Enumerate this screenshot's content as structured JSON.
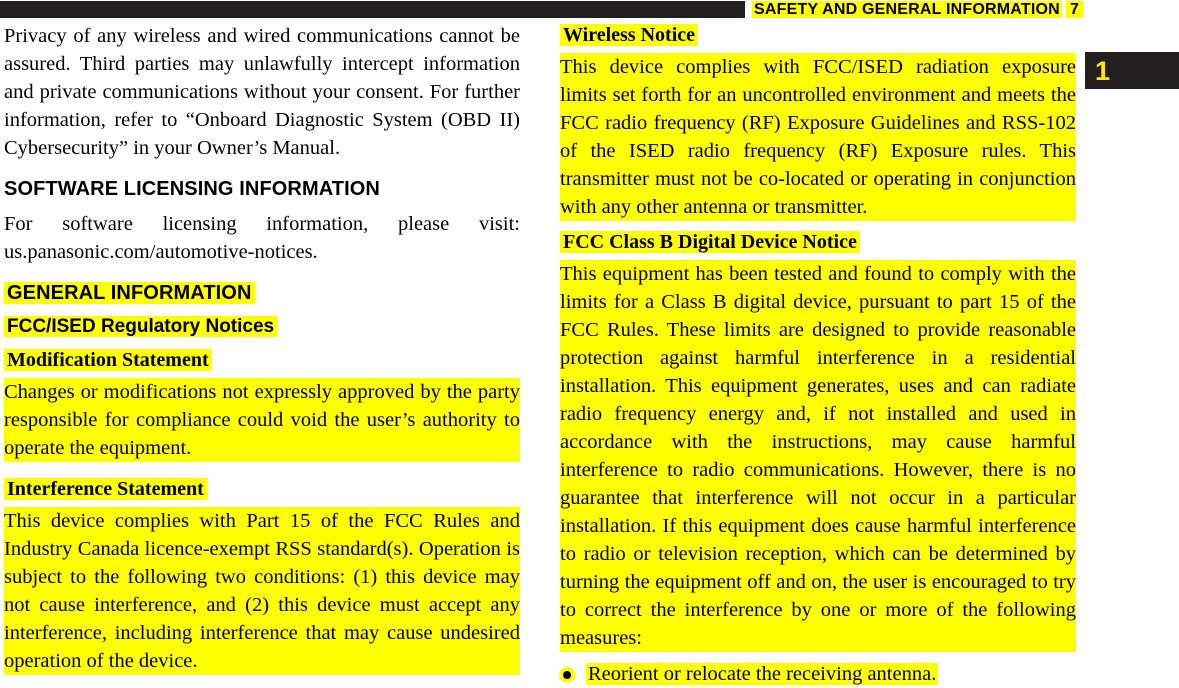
{
  "header": {
    "title": "SAFETY AND GENERAL INFORMATION",
    "page_number": "7",
    "chapter_tab_number": "1",
    "title_highlight_color": "#ffff00",
    "rule_color": "#231f20",
    "tab_color": "#231f20",
    "tab_number_color": "#ffe800"
  },
  "left_column": {
    "intro_paragraph": "Privacy of any wireless and wired communications cannot be assured. Third parties may unlawfully intercept information and private communications without your consent. For further information, refer to “Onboard Diagnostic System (OBD II) Cybersecurity” in your Owner’s Manual.",
    "software_licensing_heading": "SOFTWARE LICENSING INFORMATION",
    "software_licensing_body": "For software licensing information, please visit: us.panasonic.com/automotive-notices.",
    "general_information_heading": "GENERAL INFORMATION",
    "fcc_ised_regulatory_heading": "FCC/ISED Regulatory Notices",
    "modification_statement_heading": "Modification Statement",
    "modification_statement_body": "Changes or modifications not expressly approved by the party responsible for compliance could void the user’s authority to operate the equipment.",
    "interference_statement_heading": "Interference Statement",
    "interference_statement_body": "This device complies with Part 15 of the FCC Rules and Industry Canada licence-exempt RSS standard(s). Operation is subject to the following two conditions: (1) this device may not cause interference, and (2) this device must accept any interference, including interference that may cause undesired operation of the device."
  },
  "right_column": {
    "wireless_notice_heading": "Wireless Notice",
    "wireless_notice_body": "This device complies with FCC/ISED radiation exposure limits set forth for an uncontrolled environment and meets the FCC radio frequency (RF) Exposure Guidelines and RSS-102 of the ISED radio frequency (RF) Exposure rules. This transmitter must not be co-located or operating in conjunction with any other antenna or transmitter.",
    "fcc_class_b_heading": "FCC Class B Digital Device Notice",
    "fcc_class_b_body": "This equipment has been tested and found to comply with the limits for a Class B digital device, pursuant to part 15 of the FCC Rules. These limits are designed to provide reasonable protection against harmful interference in a residential installation. This equipment generates, uses and can radiate radio frequency energy and, if not installed and used in accordance with the instructions, may cause harmful interference to radio communications. However, there is no guarantee that interference will not occur in a particular installation. If this equipment does cause harmful interference to radio or television reception, which can be determined by turning the equipment off and on, the user is encouraged to try to correct the interference by one or more of the following measures:",
    "bullets": [
      "Reorient or relocate the receiving antenna."
    ]
  }
}
